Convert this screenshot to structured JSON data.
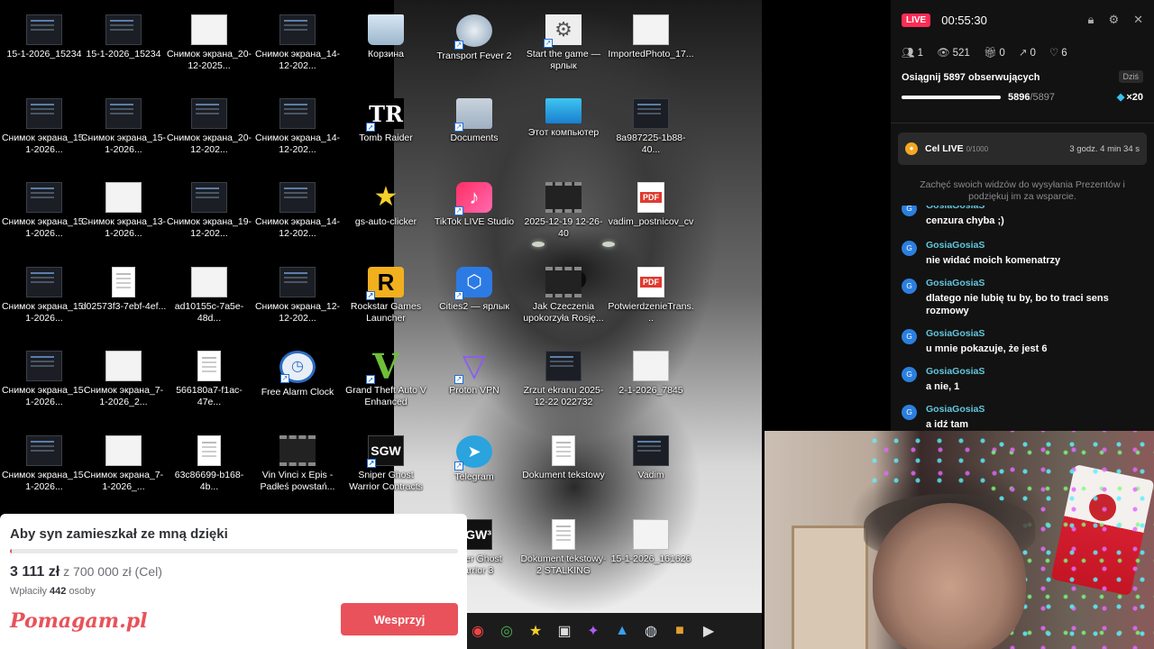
{
  "desktop": {
    "icons": [
      {
        "label": "15-1-2026_15234",
        "kind": "t-dark",
        "col": 0,
        "row": 0
      },
      {
        "label": "15-1-2026_15234",
        "kind": "t-dark",
        "col": 1,
        "row": 0
      },
      {
        "label": "Снимок экрана_20-12-2025...",
        "kind": "t-white",
        "col": 2,
        "row": 0
      },
      {
        "label": "Снимок экрана_14-12-202...",
        "kind": "t-dark",
        "col": 3,
        "row": 0
      },
      {
        "label": "Корзина",
        "kind": "t-bin",
        "col": 4,
        "row": 0
      },
      {
        "label": "Transport Fever 2",
        "kind": "t-tf",
        "col": 5,
        "row": 0,
        "shortcut": true
      },
      {
        "label": "Start the game — ярлык",
        "kind": "t-gear",
        "glyph": "⚙",
        "col": 6,
        "row": 0,
        "shortcut": true
      },
      {
        "label": "ImportedPhoto_17...",
        "kind": "t-white",
        "col": 7,
        "row": 0
      },
      {
        "label": "Снимок экрана_15-1-2026...",
        "kind": "t-dark",
        "col": 0,
        "row": 1
      },
      {
        "label": "Снимок экрана_15-1-2026...",
        "kind": "t-dark",
        "col": 1,
        "row": 1
      },
      {
        "label": "Снимок экрана_20-12-202...",
        "kind": "t-dark",
        "col": 2,
        "row": 1
      },
      {
        "label": "Снимок экрана_14-12-202...",
        "kind": "t-dark",
        "col": 3,
        "row": 1
      },
      {
        "label": "Tomb Raider",
        "kind": "t-tr",
        "glyph": "TR",
        "col": 4,
        "row": 1,
        "shortcut": true
      },
      {
        "label": "Documents",
        "kind": "t-folder",
        "col": 5,
        "row": 1,
        "shortcut": true
      },
      {
        "label": "Этот компьютер",
        "kind": "t-monitor",
        "col": 6,
        "row": 1
      },
      {
        "label": "8a987225-1b88-40...",
        "kind": "t-dark",
        "col": 7,
        "row": 1
      },
      {
        "label": "Снимок экрана_15-1-2026...",
        "kind": "t-dark",
        "col": 0,
        "row": 2
      },
      {
        "label": "Снимок экрана_13-1-2026...",
        "kind": "t-white",
        "col": 1,
        "row": 2
      },
      {
        "label": "Снимок экрана_19-12-202...",
        "kind": "t-dark",
        "col": 2,
        "row": 2
      },
      {
        "label": "Снимок экрана_14-12-202...",
        "kind": "t-dark",
        "col": 3,
        "row": 2
      },
      {
        "label": "gs-auto-clicker",
        "kind": "t-star",
        "glyph": "★",
        "col": 4,
        "row": 2
      },
      {
        "label": "TikTok LIVE Studio",
        "kind": "t-tiktok",
        "glyph": "♪",
        "col": 5,
        "row": 2,
        "shortcut": true
      },
      {
        "label": "2025-12-19 12-26-40",
        "kind": "t-film",
        "col": 6,
        "row": 2
      },
      {
        "label": "vadim_postnicov_cv",
        "kind": "t-pdf",
        "glyph": "PDF",
        "col": 7,
        "row": 2
      },
      {
        "label": "Снимок экрана_15-1-2026...",
        "kind": "t-dark",
        "col": 0,
        "row": 3
      },
      {
        "label": "d02573f3-7ebf-4ef...",
        "kind": "t-doc",
        "col": 1,
        "row": 3
      },
      {
        "label": "ad10155c-7a5e-48d...",
        "kind": "t-white",
        "col": 2,
        "row": 3
      },
      {
        "label": "Снимок экрана_12-12-202...",
        "kind": "t-dark",
        "col": 3,
        "row": 3
      },
      {
        "label": "Rockstar Games Launcher",
        "kind": "t-rockstar",
        "glyph": "R",
        "col": 4,
        "row": 3,
        "shortcut": true
      },
      {
        "label": "Cities2 — ярлык",
        "kind": "t-cities",
        "glyph": "⬡",
        "col": 5,
        "row": 3,
        "shortcut": true
      },
      {
        "label": "Jak Czeczenia upokorzyła Rosję...",
        "kind": "t-film",
        "col": 6,
        "row": 3
      },
      {
        "label": "PotwierdzenieTrans...",
        "kind": "t-pdf",
        "glyph": "PDF",
        "col": 7,
        "row": 3
      },
      {
        "label": "Снимок экрана_15-1-2026...",
        "kind": "t-dark",
        "col": 0,
        "row": 4
      },
      {
        "label": "Снимок экрана_7-1-2026_2...",
        "kind": "t-white",
        "col": 1,
        "row": 4
      },
      {
        "label": "566180a7-f1ac-47e...",
        "kind": "t-doc",
        "col": 2,
        "row": 4
      },
      {
        "label": "Free Alarm Clock",
        "kind": "t-clock",
        "glyph": "◷",
        "col": 3,
        "row": 4,
        "shortcut": true
      },
      {
        "label": "Grand Theft Auto V Enhanced",
        "kind": "t-gta",
        "glyph": "V",
        "col": 4,
        "row": 4,
        "shortcut": true
      },
      {
        "label": "Proton VPN",
        "kind": "t-proton",
        "glyph": "▽",
        "col": 5,
        "row": 4,
        "shortcut": true
      },
      {
        "label": "Zrzut ekranu 2025-12-22 022732",
        "kind": "t-dark",
        "col": 6,
        "row": 4
      },
      {
        "label": "2-1-2026_7845",
        "kind": "t-white",
        "col": 7,
        "row": 4
      },
      {
        "label": "Снимок экрана_15-1-2026...",
        "kind": "t-dark",
        "col": 0,
        "row": 5
      },
      {
        "label": "Снимок экрана_7-1-2026_...",
        "kind": "t-white",
        "col": 1,
        "row": 5
      },
      {
        "label": "63c86699-b168-4b...",
        "kind": "t-doc",
        "col": 2,
        "row": 5
      },
      {
        "label": "Vin Vinci x Epis - Padłeś powstań...",
        "kind": "t-film",
        "col": 3,
        "row": 5
      },
      {
        "label": "Sniper Ghost Warrior Contracts",
        "kind": "t-sgw",
        "glyph": "SGW",
        "col": 4,
        "row": 5,
        "shortcut": true
      },
      {
        "label": "Telegram",
        "kind": "t-telegram",
        "glyph": "➤",
        "col": 5,
        "row": 5,
        "shortcut": true
      },
      {
        "label": "Dokument tekstowy",
        "kind": "t-doc",
        "col": 6,
        "row": 5
      },
      {
        "label": "Vadim",
        "kind": "t-dark",
        "col": 7,
        "row": 5
      },
      {
        "label": "Sniper Ghost Warrior 3",
        "kind": "t-sgw",
        "glyph": "SGW³",
        "col": 5,
        "row": 6,
        "shortcut": true
      },
      {
        "label": "Dokument tekstowy-2 STALKING",
        "kind": "t-doc",
        "col": 6,
        "row": 6
      },
      {
        "label": "15-1-2026_161626",
        "kind": "t-white",
        "col": 7,
        "row": 6
      }
    ],
    "taskbar": [
      {
        "name": "app-icon",
        "glyph": "◉",
        "color": "#e44"
      },
      {
        "name": "chrome-icon",
        "glyph": "◎",
        "color": "#4caf50"
      },
      {
        "name": "autoclicker-icon",
        "glyph": "★",
        "color": "#f5d02a"
      },
      {
        "name": "package-icon",
        "glyph": "▣",
        "color": "#ddd"
      },
      {
        "name": "media-icon",
        "glyph": "✦",
        "color": "#b05cf0"
      },
      {
        "name": "photos-icon",
        "glyph": "▲",
        "color": "#3aa0f0"
      },
      {
        "name": "steam-icon",
        "glyph": "◍",
        "color": "#cfd8e3"
      },
      {
        "name": "game-icon",
        "glyph": "■",
        "color": "#e0a030"
      },
      {
        "name": "player-icon",
        "glyph": "▶",
        "color": "#ddd"
      }
    ]
  },
  "fundraiser": {
    "title": "Aby syn zamieszkał ze mną dzięki",
    "progress": 0.0044,
    "amount": "3 111 zł",
    "goal": "z 700 000 zł (Cel)",
    "payers_prefix": "Wpłaciły",
    "payers_count": "442",
    "payers_suffix": "osoby",
    "logo": "Pomagam.pl",
    "button": "Wesprzyj"
  },
  "live": {
    "badge": "LIVE",
    "time": "00:55:30",
    "stats": {
      "users": "1",
      "views": "521",
      "gifts": "0",
      "shares": "0",
      "likes": "6"
    },
    "goal": {
      "title": "Osiągnij 5897 obserwujących",
      "today": "Dziś",
      "current": "5896",
      "total": "/5897",
      "progress": 0.9998,
      "reward": "×20"
    },
    "cel": {
      "title": "Cel LIVE",
      "progress": "0/1000",
      "timer": "3 godz. 4 min 34 s"
    },
    "encourage": "Zachęć swoich widzów do wysyłania Prezentów i podziękuj im za wsparcie.",
    "chat": [
      {
        "user": "GosiaGosiaS",
        "avatar": "G",
        "text": "cenzura chyba ;)"
      },
      {
        "user": "GosiaGosiaS",
        "avatar": "G",
        "text": "nie widać moich komenatrzy"
      },
      {
        "user": "GosiaGosiaS",
        "avatar": "G",
        "text": "dlatego nie lubię tu by, bo to traci sens rozmowy"
      },
      {
        "user": "GosiaGosiaS",
        "avatar": "G",
        "text": "u mnie pokazuje, że jest 6"
      },
      {
        "user": "GosiaGosiaS",
        "avatar": "G",
        "text": "a nie, 1"
      },
      {
        "user": "GosiaGosiaS",
        "avatar": "G",
        "text": "a idź tam"
      }
    ]
  }
}
